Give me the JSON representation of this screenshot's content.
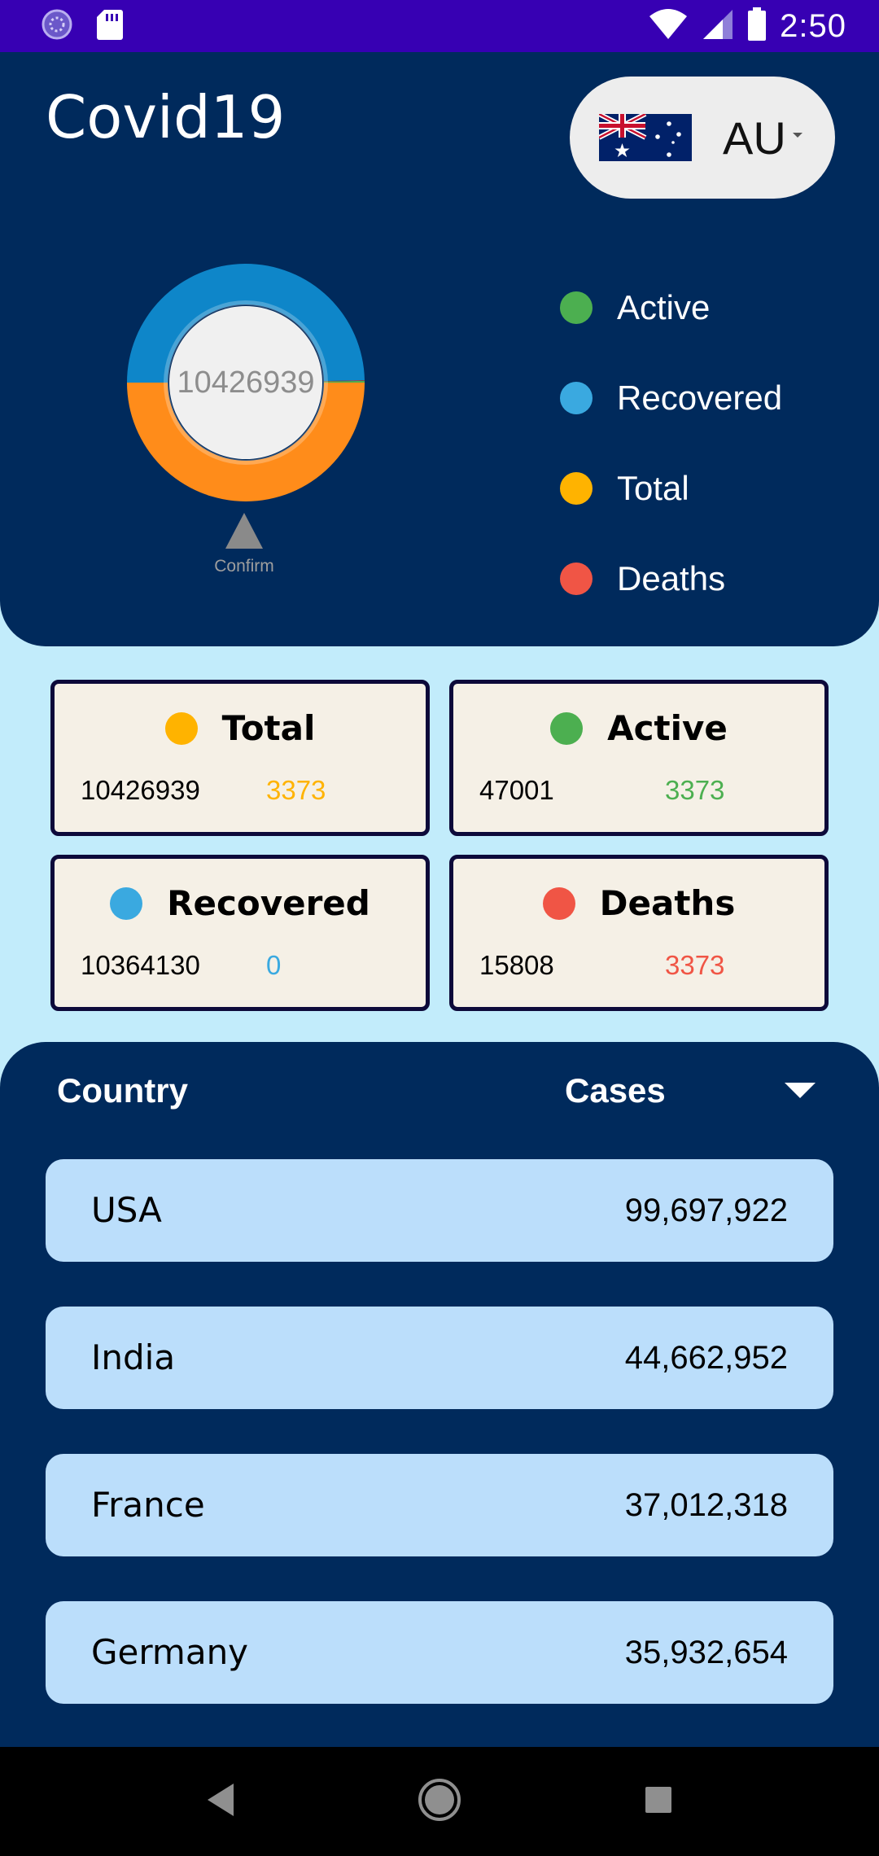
{
  "status_bar": {
    "time": "2:50",
    "icons": [
      "app-notification-icon",
      "sd-card-icon",
      "wifi-icon",
      "cell-signal-icon",
      "battery-icon"
    ]
  },
  "header": {
    "title": "Covid19",
    "country_code": "AU",
    "flag_icon": "australia-flag-icon"
  },
  "chart": {
    "center_value": "10426939",
    "marker_label": "Confirm"
  },
  "chart_data": {
    "type": "pie",
    "subtype": "donut",
    "center_label": "10426939",
    "slices": [
      {
        "name": "Recovered",
        "value": 10364130,
        "color": "#0e86c9"
      },
      {
        "name": "Deaths",
        "value": 15808,
        "color": "#d32f2f"
      },
      {
        "name": "Active",
        "value": 47001,
        "color": "#4caf50"
      },
      {
        "name": "Total",
        "value": 10426939,
        "color": "#ff8c1a"
      }
    ]
  },
  "legend": [
    {
      "label": "Active",
      "color": "#4caf50"
    },
    {
      "label": "Recovered",
      "color": "#3aa9e0"
    },
    {
      "label": "Total",
      "color": "#ffb300"
    },
    {
      "label": "Deaths",
      "color": "#f05545"
    }
  ],
  "cards": {
    "total": {
      "title": "Total",
      "value": "10426939",
      "delta": "3373",
      "color": "#ffb300"
    },
    "active": {
      "title": "Active",
      "value": "47001",
      "delta": "3373",
      "color": "#4caf50"
    },
    "recovered": {
      "title": "Recovered",
      "value": "10364130",
      "delta": "0",
      "color": "#3aa9e0"
    },
    "deaths": {
      "title": "Deaths",
      "value": "15808",
      "delta": "3373",
      "color": "#f05545"
    }
  },
  "table": {
    "country_header": "Country",
    "cases_header": "Cases",
    "rows": [
      {
        "country": "USA",
        "cases": "99,697,922"
      },
      {
        "country": "India",
        "cases": "44,662,952"
      },
      {
        "country": "France",
        "cases": "37,012,318"
      },
      {
        "country": "Germany",
        "cases": "35,932,654"
      }
    ]
  },
  "nav": {
    "icons": [
      "back-icon",
      "home-icon",
      "recents-icon"
    ]
  },
  "colors": {
    "status_bar": "#3700b3",
    "panel": "#002a5c",
    "background": "#c2ecfb",
    "row": "#bbdefb",
    "card": "#f5f0e6"
  }
}
